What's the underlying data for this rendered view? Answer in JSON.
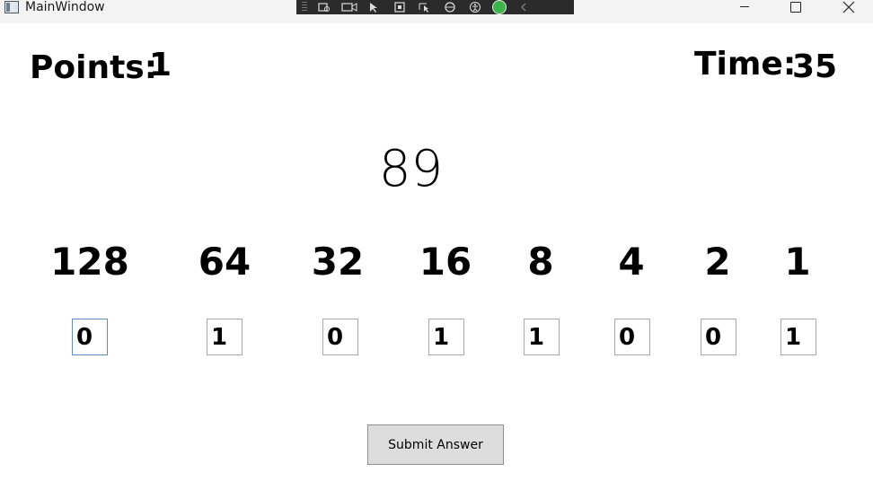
{
  "window": {
    "title": "MainWindow"
  },
  "score": {
    "points_label": "Points:",
    "points_value": "1",
    "time_label": "Time:",
    "time_value": "35"
  },
  "target_number": "89",
  "bits": [
    {
      "weight": "128",
      "value": "0"
    },
    {
      "weight": "64",
      "value": "1"
    },
    {
      "weight": "32",
      "value": "0"
    },
    {
      "weight": "16",
      "value": "1"
    },
    {
      "weight": "8",
      "value": "1"
    },
    {
      "weight": "4",
      "value": "0"
    },
    {
      "weight": "2",
      "value": "0"
    },
    {
      "weight": "1",
      "value": "1"
    }
  ],
  "actions": {
    "submit_label": "Submit Answer"
  },
  "colors": {
    "focus_border": "#5b8fd1",
    "button_bg": "#dddddd"
  }
}
